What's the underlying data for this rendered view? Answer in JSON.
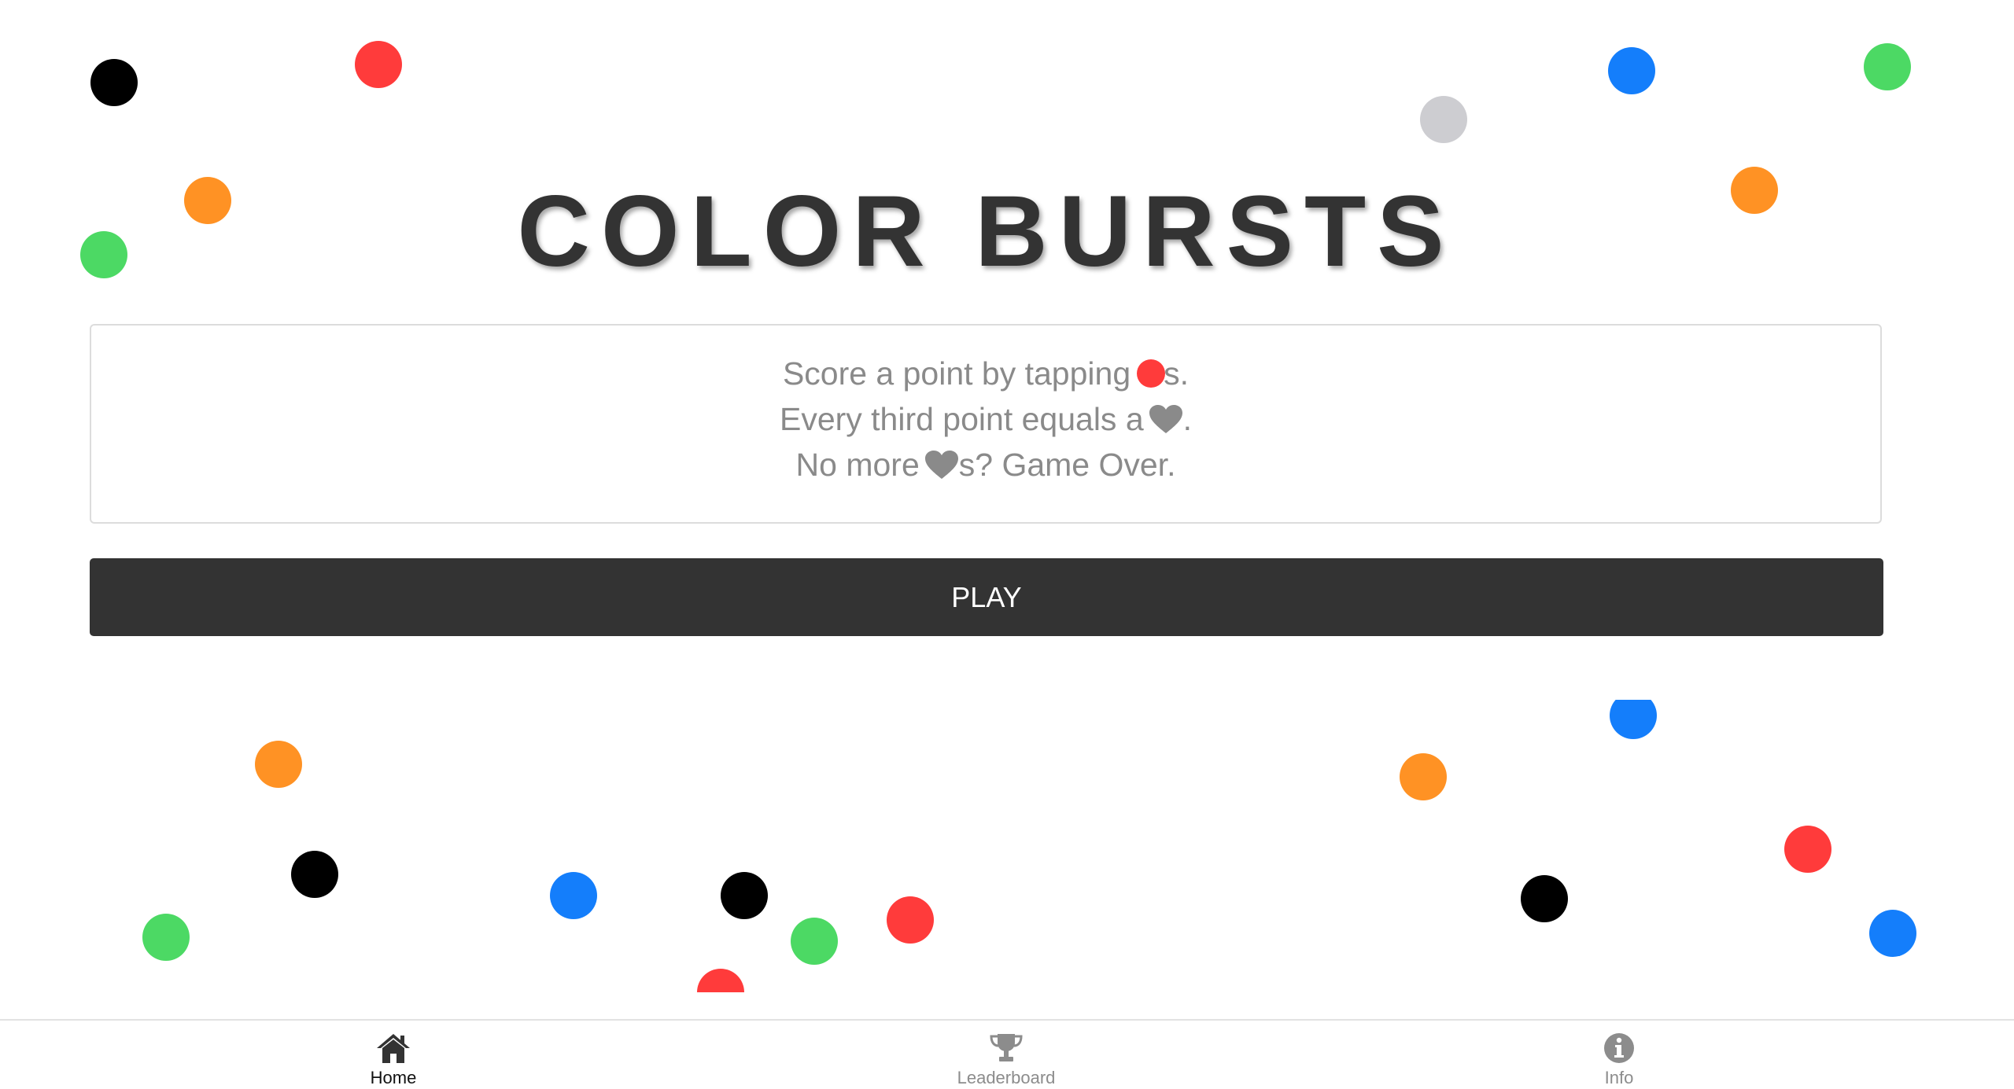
{
  "title": "COLOR BURSTS",
  "instructions": {
    "line1_before": "Score a point by tapping",
    "line1_after": "s.",
    "line2_before": "Every third point equals a",
    "line2_after": ".",
    "line3_before": "No more",
    "line3_after": "s? Game Over."
  },
  "play_button_label": "PLAY",
  "nav": {
    "home_label": "Home",
    "leaderboard_label": "Leaderboard",
    "info_label": "Info",
    "active_tab": "Home"
  },
  "colors": {
    "target_dot": "#ff3b3b",
    "red": "#ff3b3b",
    "orange": "#ff9224",
    "green": "#4cd964",
    "blue": "#147efb",
    "black": "#000000",
    "gray": "#cdcdd1",
    "button": "#333333",
    "heart": "#8a8a8a"
  },
  "icons": {
    "target": "red-dot-icon",
    "life": "heart-icon",
    "home": "home-icon",
    "leaderboard": "trophy-icon",
    "info": "info-icon"
  }
}
